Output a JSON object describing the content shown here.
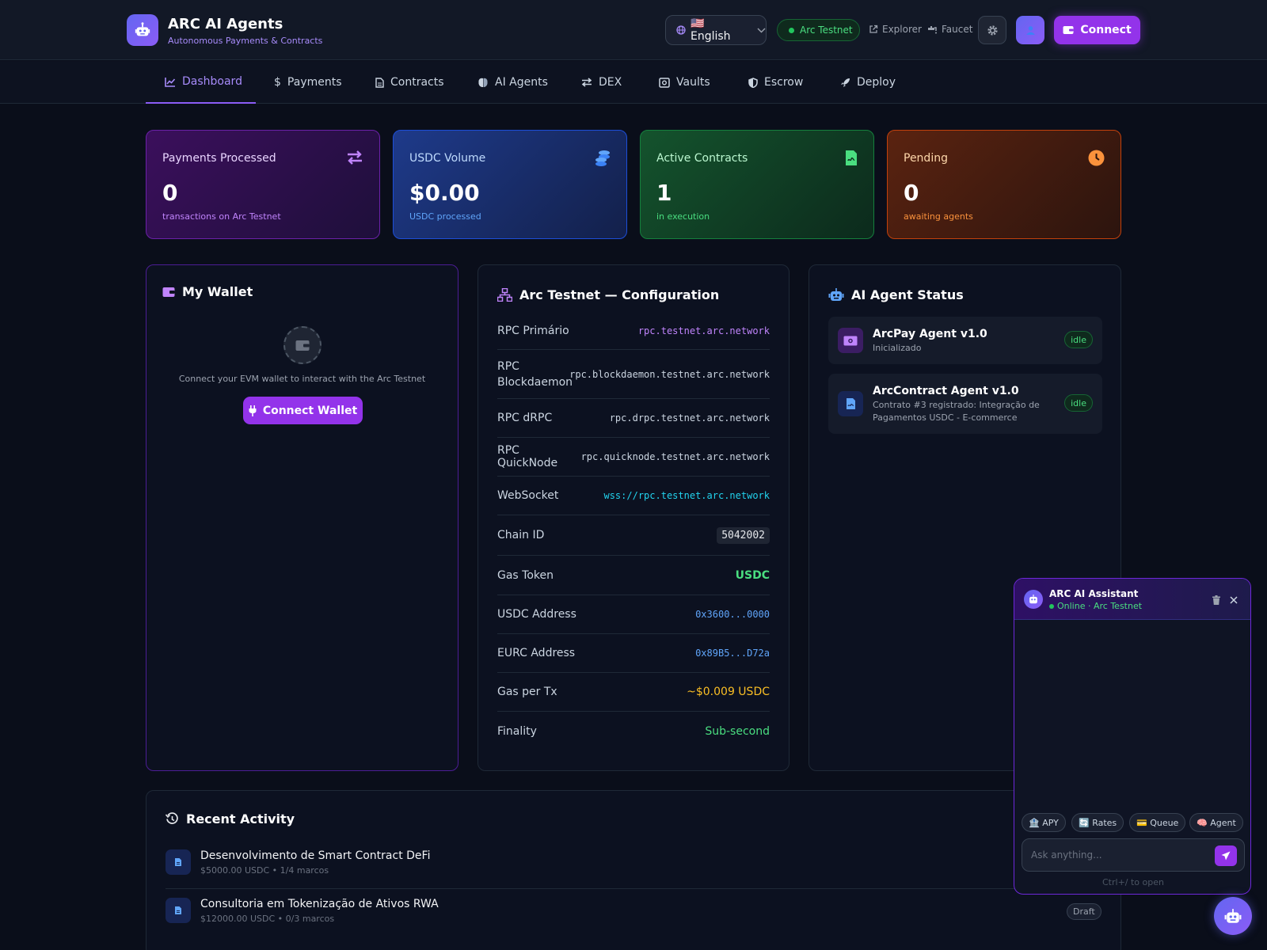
{
  "header": {
    "app_title": "ARC AI Agents",
    "app_subtitle": "Autonomous Payments & Contracts",
    "language": "🇺🇸 English",
    "network_badge": "Arc Testnet",
    "explorer_label": "Explorer",
    "faucet_label": "Faucet",
    "connect_label": "Connect"
  },
  "nav": {
    "tabs": [
      {
        "label": "Dashboard",
        "icon": "chart-line-icon",
        "active": true
      },
      {
        "label": "Payments",
        "icon": "dollar-icon"
      },
      {
        "label": "Contracts",
        "icon": "file-contract-icon"
      },
      {
        "label": "AI Agents",
        "icon": "brain-icon"
      },
      {
        "label": "DEX",
        "icon": "exchange-icon"
      },
      {
        "label": "Vaults",
        "icon": "vault-icon"
      },
      {
        "label": "Escrow",
        "icon": "shield-icon"
      },
      {
        "label": "Deploy",
        "icon": "rocket-icon"
      }
    ]
  },
  "stats": [
    {
      "label": "Payments Processed",
      "value": "0",
      "sub": "transactions on Arc Testnet",
      "icon": "arrows-exchange-icon",
      "color": "#c084fc"
    },
    {
      "label": "USDC Volume",
      "value": "$0.00",
      "sub": "USDC processed",
      "icon": "coins-icon",
      "color": "#60a5fa"
    },
    {
      "label": "Active Contracts",
      "value": "1",
      "sub": "in execution",
      "icon": "file-contract-icon",
      "color": "#4ade80"
    },
    {
      "label": "Pending",
      "value": "0",
      "sub": "awaiting agents",
      "icon": "clock-icon",
      "color": "#fb923c"
    }
  ],
  "wallet": {
    "title": "My Wallet",
    "message": "Connect your EVM wallet to interact with the Arc Testnet",
    "button": "Connect Wallet"
  },
  "config": {
    "title": "Arc Testnet — Configuration",
    "rows": [
      {
        "label": "RPC Primário",
        "value": "rpc.testnet.arc.network",
        "color": "#c084fc"
      },
      {
        "label": "RPC Blockdaemon",
        "value": "rpc.blockdaemon.testnet.arc.network",
        "color": "#cbd5e1"
      },
      {
        "label": "RPC dRPC",
        "value": "rpc.drpc.testnet.arc.network",
        "color": "#cbd5e1"
      },
      {
        "label": "RPC QuickNode",
        "value": "rpc.quicknode.testnet.arc.network",
        "color": "#cbd5e1"
      },
      {
        "label": "WebSocket",
        "value": "wss://rpc.testnet.arc.network",
        "color": "#22d3ee"
      },
      {
        "label": "Chain ID",
        "value": "5042002",
        "color": "#e5e7eb"
      },
      {
        "label": "Gas Token",
        "value": "USDC",
        "color": "#4ade80"
      },
      {
        "label": "USDC Address",
        "value": "0x3600...0000",
        "color": "#60a5fa"
      },
      {
        "label": "EURC Address",
        "value": "0x89B5...D72a",
        "color": "#60a5fa"
      },
      {
        "label": "Gas per Tx",
        "value": "~$0.009 USDC",
        "color": "#fbbf24"
      },
      {
        "label": "Finality",
        "value": "Sub-second",
        "color": "#4ade80"
      }
    ]
  },
  "agents": {
    "title": "AI Agent Status",
    "items": [
      {
        "name": "ArcPay Agent v1.0",
        "desc": "Inicializado",
        "status": "idle",
        "icon": "money-icon"
      },
      {
        "name": "ArcContract Agent v1.0",
        "desc": "Contrato #3 registrado: Integração de Pagamentos USDC - E-commerce",
        "status": "idle",
        "icon": "file-contract-icon"
      }
    ]
  },
  "activity": {
    "title": "Recent Activity",
    "items": [
      {
        "title": "Desenvolvimento de Smart Contract DeFi",
        "sub": "$5000.00 USDC • 1/4 marcos",
        "badge": ""
      },
      {
        "title": "Consultoria em Tokenização de Ativos RWA",
        "sub": "$12000.00 USDC • 0/3 marcos",
        "badge": "Draft"
      }
    ]
  },
  "chat": {
    "title": "ARC AI Assistant",
    "status": "Online · Arc Testnet",
    "chips": [
      "🏦 APY",
      "🔄 Rates",
      "💳 Queue",
      "🧠 Agent"
    ],
    "placeholder": "Ask anything...",
    "hint": "Ctrl+/ to open"
  }
}
